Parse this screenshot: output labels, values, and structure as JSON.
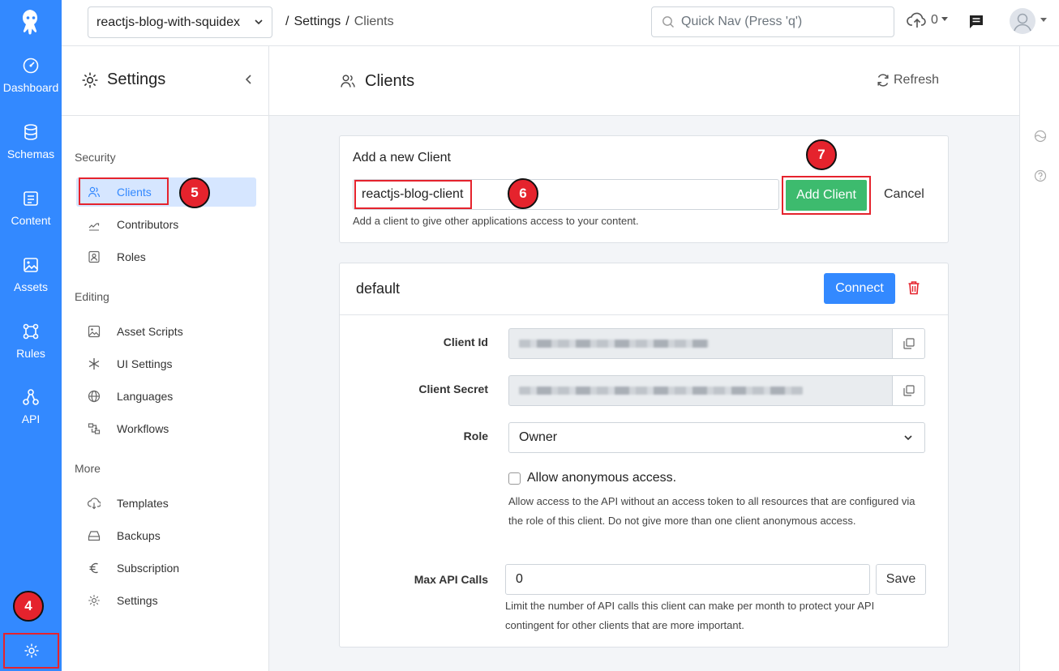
{
  "rail": {
    "items": [
      {
        "label": "Dashboard",
        "icon": "gauge-icon"
      },
      {
        "label": "Schemas",
        "icon": "database-icon"
      },
      {
        "label": "Content",
        "icon": "content-icon"
      },
      {
        "label": "Assets",
        "icon": "image-icon"
      },
      {
        "label": "Rules",
        "icon": "rules-icon"
      },
      {
        "label": "API",
        "icon": "api-icon"
      }
    ]
  },
  "topbar": {
    "app_name": "reactjs-blog-with-squidex",
    "breadcrumb": [
      "/",
      "Settings",
      "/",
      "Clients"
    ],
    "quicknav_placeholder": "Quick Nav (Press 'q')",
    "upload_count": "0"
  },
  "sidebar": {
    "title": "Settings",
    "groups": [
      {
        "label": "Security",
        "items": [
          "Clients",
          "Contributors",
          "Roles"
        ]
      },
      {
        "label": "Editing",
        "items": [
          "Asset Scripts",
          "UI Settings",
          "Languages",
          "Workflows"
        ]
      },
      {
        "label": "More",
        "items": [
          "Templates",
          "Backups",
          "Subscription",
          "Settings"
        ]
      }
    ],
    "active_item": "Clients"
  },
  "main": {
    "title": "Clients",
    "refresh_label": "Refresh",
    "add_client": {
      "heading": "Add a new Client",
      "input_value": "reactjs-blog-client",
      "add_label": "Add Client",
      "cancel_label": "Cancel",
      "hint": "Add a client to give other applications access to your content."
    },
    "client": {
      "name": "default",
      "connect_label": "Connect",
      "client_id_label": "Client Id",
      "client_secret_label": "Client Secret",
      "role_label": "Role",
      "role_value": "Owner",
      "anonymous_label": "Allow anonymous access.",
      "anonymous_checked": false,
      "anonymous_help": "Allow access to the API without an access token to all resources that are configured via the role of this client. Do not give more than one client anonymous access.",
      "max_calls_label": "Max API Calls",
      "max_calls_value": "0",
      "save_label": "Save",
      "max_calls_help": "Limit the number of API calls this client can make per month to protect your API contingent for other clients that are more important."
    }
  },
  "steps": [
    "4",
    "5",
    "6",
    "7"
  ],
  "colors": {
    "brand": "#3389ff",
    "success": "#3dbb6e",
    "danger": "#e5232d",
    "active_bg": "#d6e6ff"
  }
}
